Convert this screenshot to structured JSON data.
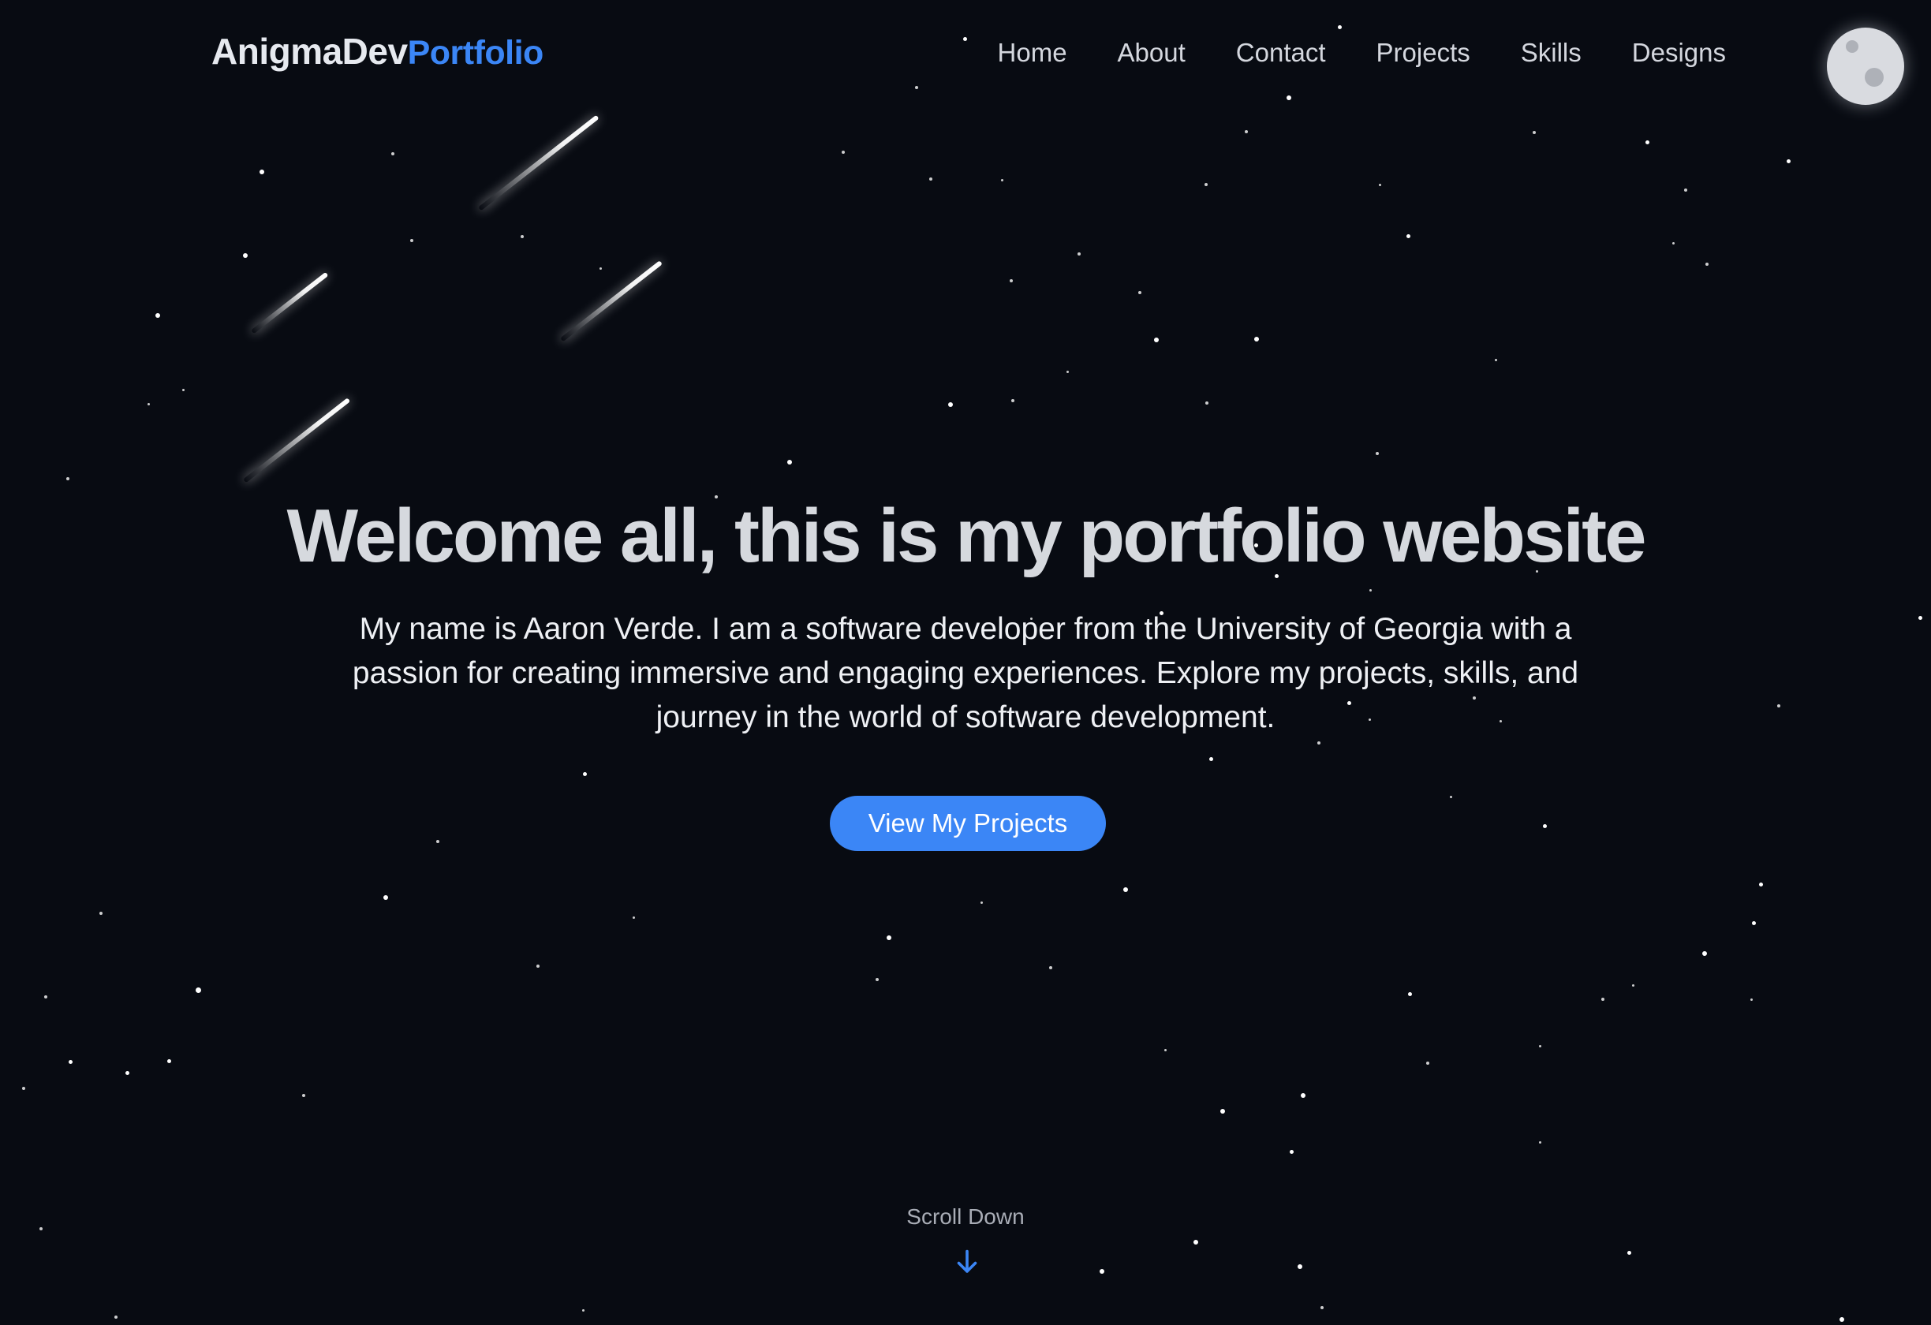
{
  "brand": {
    "name": "AnigmaDev",
    "accent": "Portfolio"
  },
  "nav": {
    "items": [
      "Home",
      "About",
      "Contact",
      "Projects",
      "Skills",
      "Designs"
    ]
  },
  "theme_toggle": {
    "icon": "moon-icon"
  },
  "hero": {
    "title": "Welcome all, this is my portfolio website",
    "description": "My name is Aaron Verde. I am a software developer from the University of Georgia with a passion for creating immersive and engaging experiences. Explore my projects, skills, and journey in the world of software development.",
    "cta_label": "View My Projects"
  },
  "scroll": {
    "label": "Scroll Down",
    "icon": "arrow-down-icon"
  },
  "colors": {
    "background": "#080b12",
    "accent": "#3b86f6",
    "text": "#d6d9de",
    "moon": "#d9dbe0"
  }
}
